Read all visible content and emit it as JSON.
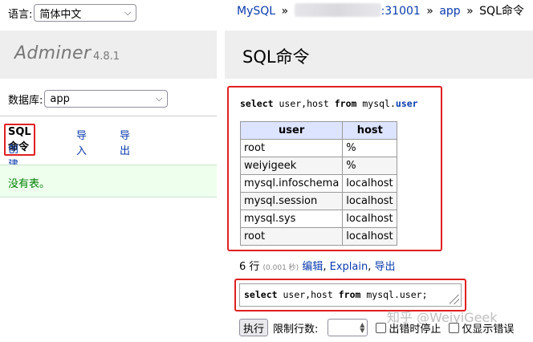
{
  "sidebar": {
    "language_label": "语言:",
    "language_value": "简体中文",
    "app_name": "Adminer",
    "app_version": "4.8.1",
    "database_label": "数据库:",
    "database_value": "app",
    "links": {
      "sql_command": "SQL命令",
      "import": "导入",
      "export": "导出",
      "create_table": "创建表"
    },
    "no_tables": "没有表。"
  },
  "breadcrumb": {
    "driver": "MySQL",
    "separator": "»",
    "server_suffix": ":31001",
    "database": "app",
    "current": "SQL命令"
  },
  "main": {
    "title": "SQL命令",
    "executed_query": {
      "kw_select": "select",
      "columns": " user,host ",
      "kw_from": "from",
      "schema": " mysql.",
      "table": "user"
    },
    "result_table": {
      "headers": [
        "user",
        "host"
      ],
      "rows": [
        [
          "root",
          "%"
        ],
        [
          "weiyigeek",
          "%"
        ],
        [
          "mysql.infoschema",
          "localhost"
        ],
        [
          "mysql.session",
          "localhost"
        ],
        [
          "mysql.sys",
          "localhost"
        ],
        [
          "root",
          "localhost"
        ]
      ]
    },
    "row_info": {
      "count": "6 行",
      "time": "(0.001 秒)",
      "edit": "编辑",
      "explain": "Explain",
      "export": "导出"
    },
    "editor": {
      "kw_select": "select",
      "columns": " user,host ",
      "kw_from": "from",
      "rest": " mysql.user;"
    },
    "execute_button": "执行",
    "limit_label": "限制行数:",
    "stop_on_error_label": "出错时停止",
    "only_show_errors_label": "仅显示错误"
  },
  "watermark": "知乎 @WeiyiGeek",
  "colors": {
    "link": "#0a3bad",
    "highlight_border": "#e02020",
    "header_bg": "#dde4ff",
    "band_bg": "#eeeeee",
    "success_bg": "#eeffee"
  }
}
